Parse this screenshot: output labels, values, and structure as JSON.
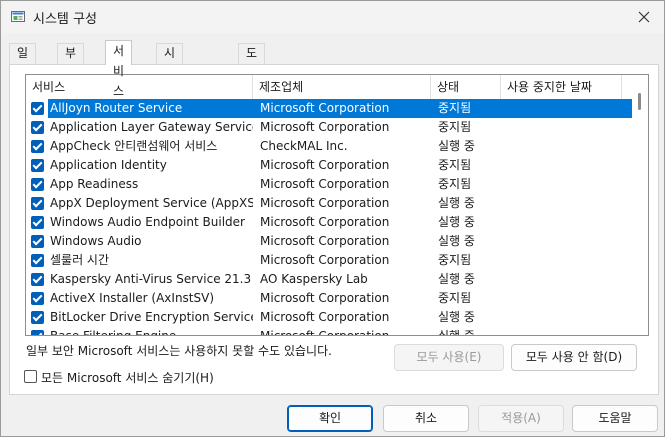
{
  "window": {
    "title": "시스템 구성"
  },
  "tabs": [
    {
      "label": "일반"
    },
    {
      "label": "부팅"
    },
    {
      "label": "서비스"
    },
    {
      "label": "시작프로그램"
    },
    {
      "label": "도구"
    }
  ],
  "active_tab": "서비스",
  "table": {
    "columns": [
      "서비스",
      "제조업체",
      "상태",
      "사용 중지한 날짜"
    ],
    "rows": [
      {
        "name": "AllJoyn Router Service",
        "manufacturer": "Microsoft Corporation",
        "status": "중지됨",
        "checked": true,
        "selected": true
      },
      {
        "name": "Application Layer Gateway Service",
        "manufacturer": "Microsoft Corporation",
        "status": "중지됨",
        "checked": true
      },
      {
        "name": "AppCheck 안티랜섬웨어 서비스",
        "manufacturer": "CheckMAL Inc.",
        "status": "실행 중",
        "checked": true
      },
      {
        "name": "Application Identity",
        "manufacturer": "Microsoft Corporation",
        "status": "중지됨",
        "checked": true
      },
      {
        "name": "App Readiness",
        "manufacturer": "Microsoft Corporation",
        "status": "중지됨",
        "checked": true
      },
      {
        "name": "AppX Deployment Service (AppXSV...",
        "manufacturer": "Microsoft Corporation",
        "status": "실행 중",
        "checked": true
      },
      {
        "name": "Windows Audio Endpoint Builder",
        "manufacturer": "Microsoft Corporation",
        "status": "실행 중",
        "checked": true
      },
      {
        "name": "Windows Audio",
        "manufacturer": "Microsoft Corporation",
        "status": "실행 중",
        "checked": true
      },
      {
        "name": "셀룰러 시간",
        "manufacturer": "Microsoft Corporation",
        "status": "중지됨",
        "checked": true
      },
      {
        "name": "Kaspersky Anti-Virus Service 21.3",
        "manufacturer": "AO Kaspersky Lab",
        "status": "실행 중",
        "checked": true
      },
      {
        "name": "ActiveX Installer (AxInstSV)",
        "manufacturer": "Microsoft Corporation",
        "status": "중지됨",
        "checked": true
      },
      {
        "name": "BitLocker Drive Encryption Service",
        "manufacturer": "Microsoft Corporation",
        "status": "실행 중",
        "checked": true
      },
      {
        "name": "Base Filtering Engine",
        "manufacturer": "Microsoft Corporation",
        "status": "실행 중",
        "checked": true
      }
    ]
  },
  "note": "일부 보안 Microsoft 서비스는 사용하지 못할 수도 있습니다.",
  "hide_ms_label": "모든 Microsoft 서비스 숨기기(H)",
  "buttons": {
    "enable_all": "모두 사용(E)",
    "disable_all": "모두 사용 안 함(D)",
    "ok": "확인",
    "cancel": "취소",
    "apply": "적용(A)",
    "help": "도움말"
  }
}
